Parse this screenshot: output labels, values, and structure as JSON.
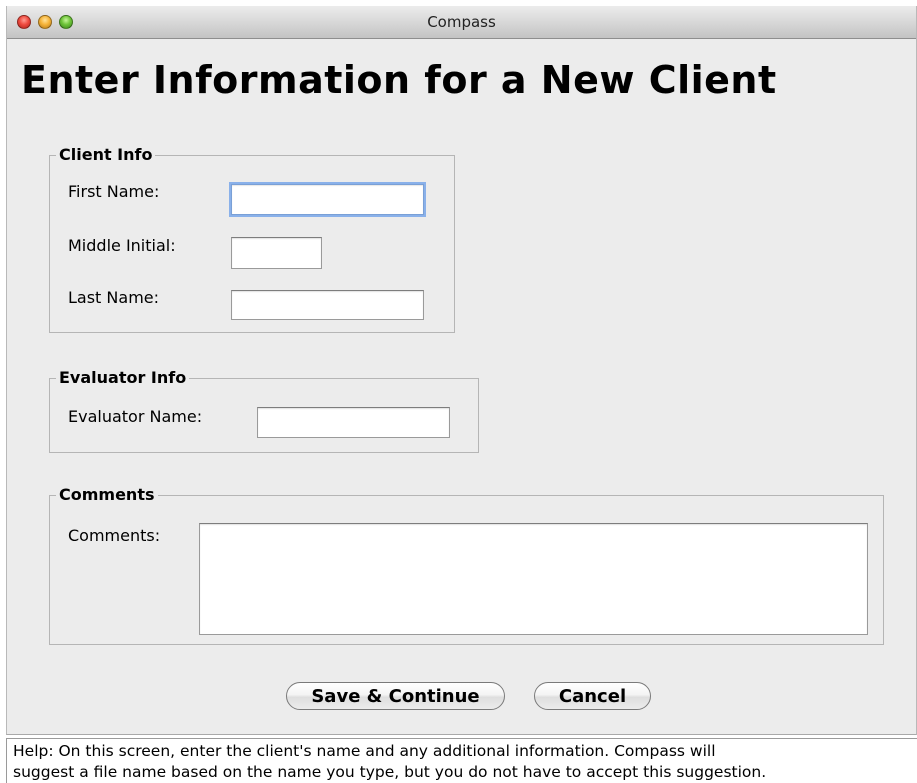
{
  "window": {
    "title": "Compass"
  },
  "heading": "Enter Information for a New Client",
  "client_info": {
    "legend": "Client Info",
    "first_name": {
      "label": "First Name:",
      "value": ""
    },
    "middle_initial": {
      "label": "Middle Initial:",
      "value": ""
    },
    "last_name": {
      "label": "Last Name:",
      "value": ""
    }
  },
  "evaluator_info": {
    "legend": "Evaluator Info",
    "evaluator_name": {
      "label": "Evaluator Name:",
      "value": ""
    }
  },
  "comments": {
    "legend": "Comments",
    "field": {
      "label": "Comments:",
      "value": ""
    }
  },
  "buttons": {
    "save": "Save & Continue",
    "cancel": "Cancel"
  },
  "help": {
    "line1": "Help:  On this screen, enter the client's name and any additional information.  Compass will",
    "line2": "suggest a file name based on the name you type, but you do not have to accept this suggestion."
  },
  "colors": {
    "window_bg": "#ececec",
    "focus_ring": "#8ab1ea",
    "close": "#ef4b40",
    "minimize": "#f6b43a",
    "maximize": "#6fc43a"
  }
}
